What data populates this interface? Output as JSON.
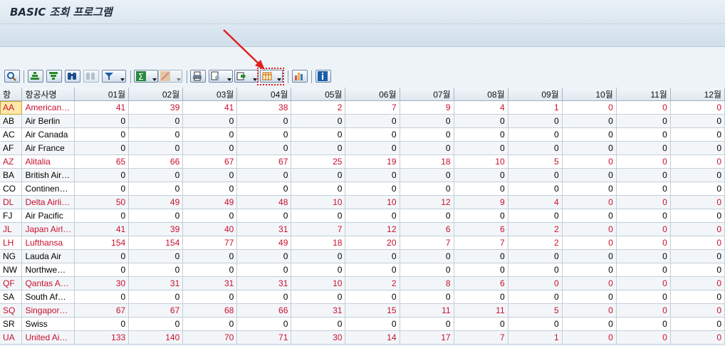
{
  "window": {
    "title": "BASIC 조회 프로그램"
  },
  "toolbar": {
    "buttons": [
      {
        "name": "details-icon"
      },
      {
        "name": "sort-ascending-icon"
      },
      {
        "name": "sort-descending-icon"
      },
      {
        "name": "find-icon"
      },
      {
        "name": "find-next-icon"
      },
      {
        "name": "filter-icon"
      },
      {
        "name": "sum-icon"
      },
      {
        "name": "subtotal-icon"
      },
      {
        "name": "print-icon"
      },
      {
        "name": "view-icon"
      },
      {
        "name": "export-icon"
      },
      {
        "name": "layout-icon"
      },
      {
        "name": "graphic-icon"
      },
      {
        "name": "info-icon"
      }
    ]
  },
  "colors": {
    "highlight_values": "#c8102e",
    "annotation_arrow": "#e02020"
  },
  "table": {
    "columns": [
      "항",
      "항공사명",
      "01월",
      "02월",
      "03월",
      "04월",
      "05월",
      "06월",
      "07월",
      "08월",
      "09월",
      "10월",
      "11월",
      "12월"
    ],
    "rows": [
      {
        "code": "AA",
        "name": "American…",
        "months": [
          "41",
          "39",
          "41",
          "38",
          "2",
          "7",
          "9",
          "4",
          "1",
          "0",
          "0",
          "0"
        ],
        "red": true
      },
      {
        "code": "AB",
        "name": "Air Berlin",
        "months": [
          "0",
          "0",
          "0",
          "0",
          "0",
          "0",
          "0",
          "0",
          "0",
          "0",
          "0",
          "0"
        ],
        "red": false
      },
      {
        "code": "AC",
        "name": "Air Canada",
        "months": [
          "0",
          "0",
          "0",
          "0",
          "0",
          "0",
          "0",
          "0",
          "0",
          "0",
          "0",
          "0"
        ],
        "red": false
      },
      {
        "code": "AF",
        "name": "Air France",
        "months": [
          "0",
          "0",
          "0",
          "0",
          "0",
          "0",
          "0",
          "0",
          "0",
          "0",
          "0",
          "0"
        ],
        "red": false
      },
      {
        "code": "AZ",
        "name": "Alitalia",
        "months": [
          "65",
          "66",
          "67",
          "67",
          "25",
          "19",
          "18",
          "10",
          "5",
          "0",
          "0",
          "0"
        ],
        "red": true
      },
      {
        "code": "BA",
        "name": "British Air…",
        "months": [
          "0",
          "0",
          "0",
          "0",
          "0",
          "0",
          "0",
          "0",
          "0",
          "0",
          "0",
          "0"
        ],
        "red": false
      },
      {
        "code": "CO",
        "name": "Continen…",
        "months": [
          "0",
          "0",
          "0",
          "0",
          "0",
          "0",
          "0",
          "0",
          "0",
          "0",
          "0",
          "0"
        ],
        "red": false
      },
      {
        "code": "DL",
        "name": "Delta Airli…",
        "months": [
          "50",
          "49",
          "49",
          "48",
          "10",
          "10",
          "12",
          "9",
          "4",
          "0",
          "0",
          "0"
        ],
        "red": true
      },
      {
        "code": "FJ",
        "name": "Air Pacific",
        "months": [
          "0",
          "0",
          "0",
          "0",
          "0",
          "0",
          "0",
          "0",
          "0",
          "0",
          "0",
          "0"
        ],
        "red": false
      },
      {
        "code": "JL",
        "name": "Japan Airl…",
        "months": [
          "41",
          "39",
          "40",
          "31",
          "7",
          "12",
          "6",
          "6",
          "2",
          "0",
          "0",
          "0"
        ],
        "red": true
      },
      {
        "code": "LH",
        "name": "Lufthansa",
        "months": [
          "154",
          "154",
          "77",
          "49",
          "18",
          "20",
          "7",
          "7",
          "2",
          "0",
          "0",
          "0"
        ],
        "red": true
      },
      {
        "code": "NG",
        "name": "Lauda Air",
        "months": [
          "0",
          "0",
          "0",
          "0",
          "0",
          "0",
          "0",
          "0",
          "0",
          "0",
          "0",
          "0"
        ],
        "red": false
      },
      {
        "code": "NW",
        "name": "Northwe…",
        "months": [
          "0",
          "0",
          "0",
          "0",
          "0",
          "0",
          "0",
          "0",
          "0",
          "0",
          "0",
          "0"
        ],
        "red": false
      },
      {
        "code": "QF",
        "name": "Qantas A…",
        "months": [
          "30",
          "31",
          "31",
          "31",
          "10",
          "2",
          "8",
          "6",
          "0",
          "0",
          "0",
          "0"
        ],
        "red": true
      },
      {
        "code": "SA",
        "name": "South Af…",
        "months": [
          "0",
          "0",
          "0",
          "0",
          "0",
          "0",
          "0",
          "0",
          "0",
          "0",
          "0",
          "0"
        ],
        "red": false
      },
      {
        "code": "SQ",
        "name": "Singapor…",
        "months": [
          "67",
          "67",
          "68",
          "66",
          "31",
          "15",
          "11",
          "11",
          "5",
          "0",
          "0",
          "0"
        ],
        "red": true
      },
      {
        "code": "SR",
        "name": "Swiss",
        "months": [
          "0",
          "0",
          "0",
          "0",
          "0",
          "0",
          "0",
          "0",
          "0",
          "0",
          "0",
          "0"
        ],
        "red": false
      },
      {
        "code": "UA",
        "name": "United Ai…",
        "months": [
          "133",
          "140",
          "70",
          "71",
          "30",
          "14",
          "17",
          "7",
          "1",
          "0",
          "0",
          "0"
        ],
        "red": true
      }
    ]
  }
}
